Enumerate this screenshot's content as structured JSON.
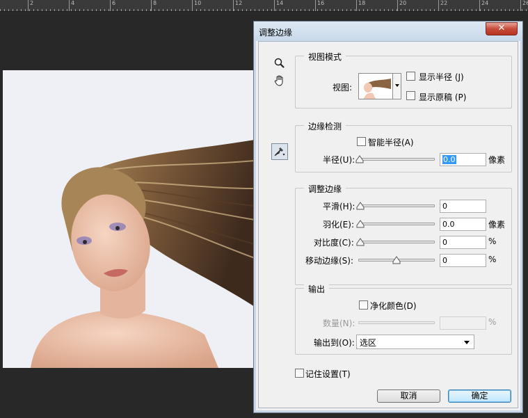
{
  "ruler": {
    "labels": [
      "2",
      "4",
      "6",
      "8",
      "10",
      "12",
      "14",
      "16",
      "18",
      "20",
      "22",
      "24",
      "26"
    ]
  },
  "dialog": {
    "title": "调整边缘",
    "close_glyph": "✕"
  },
  "view_mode": {
    "legend": "视图模式",
    "view_label": "视图:",
    "show_radius": "显示半径 (J)",
    "show_original": "显示原稿 (P)"
  },
  "edge_detection": {
    "legend": "边缘检测",
    "smart_radius": "智能半径(A)",
    "radius_label": "半径(U):",
    "radius_value": "0.0",
    "radius_unit": "像素"
  },
  "adjust_edge": {
    "legend": "调整边缘",
    "smooth_label": "平滑(H):",
    "smooth_value": "0",
    "smooth_level": 0,
    "feather_label": "羽化(E):",
    "feather_value": "0.0",
    "feather_unit": "像素",
    "feather_level": 0,
    "contrast_label": "对比度(C):",
    "contrast_value": "0",
    "contrast_unit": "%",
    "contrast_level": 0,
    "shift_label": "移动边缘(S):",
    "shift_value": "0",
    "shift_unit": "%",
    "shift_level": 0.5
  },
  "output": {
    "legend": "输出",
    "decontaminate": "净化颜色(D)",
    "amount_label": "数量(N):",
    "amount_unit": "%",
    "output_to_label": "输出到(O):",
    "output_to_value": "选区"
  },
  "remember_settings": "记住设置(T)",
  "buttons": {
    "cancel": "取消",
    "ok": "确定"
  },
  "colors": {
    "window_bg": "#282828",
    "dialog_bg": "#f0f0f0",
    "close_red": "#c74b3a",
    "focus_blue": "#3399ff"
  }
}
